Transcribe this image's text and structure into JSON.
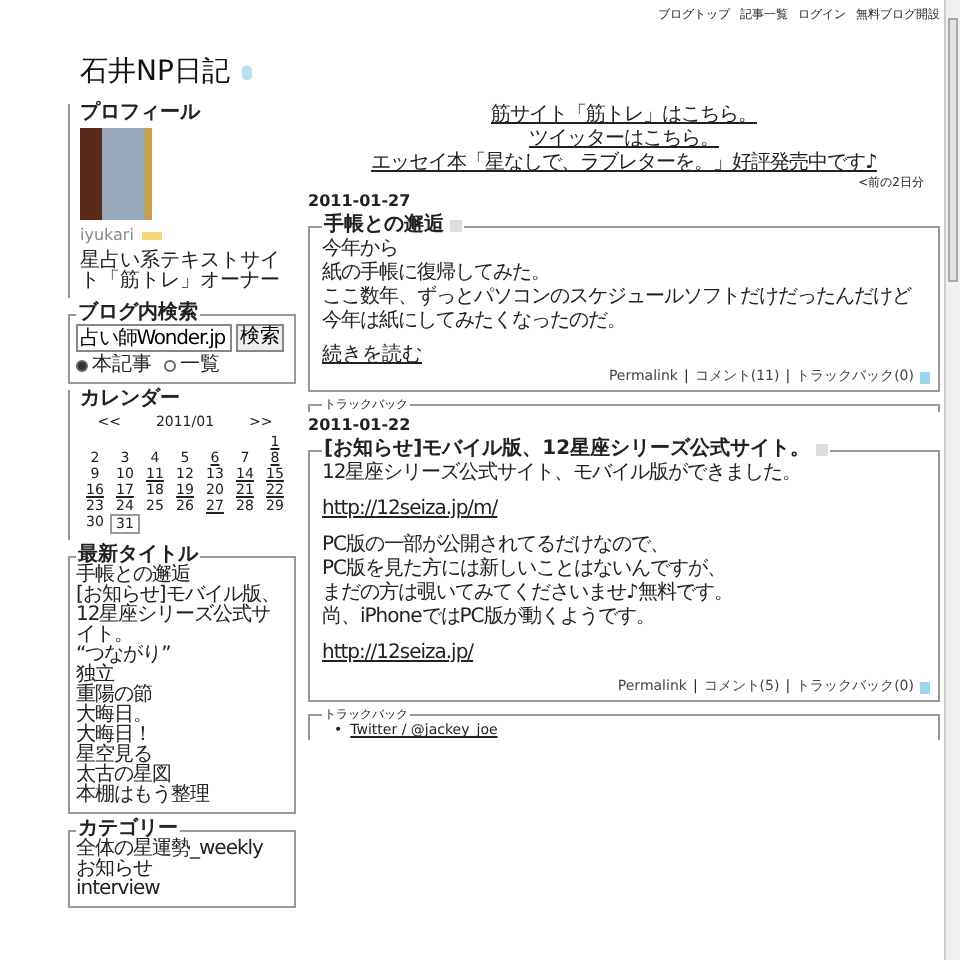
{
  "header_links": [
    "ブログトップ",
    "記事一覧",
    "ログイン",
    "無料ブログ開設"
  ],
  "blog_title": "石井NP日記",
  "sidebar": {
    "profile": {
      "heading": "プロフィール",
      "name": "iyukari",
      "description": "星占い系テキストサイト「筋トレ」オーナー"
    },
    "search": {
      "heading": "ブログ内検索",
      "value": "占い師Wonder.jp",
      "button": "検索",
      "options": [
        {
          "label": "本記事",
          "selected": true
        },
        {
          "label": "一覧",
          "selected": false
        }
      ]
    },
    "calendar": {
      "heading": "カレンダー",
      "prev": "<<",
      "month": "2011/01",
      "next": ">>",
      "weeks": [
        [
          {
            "kind": "empty"
          },
          {
            "kind": "empty"
          },
          {
            "kind": "empty"
          },
          {
            "kind": "empty"
          },
          {
            "kind": "empty"
          },
          {
            "kind": "empty"
          },
          {
            "kind": "day",
            "day": "1",
            "linked": true,
            "today": false
          }
        ],
        [
          {
            "kind": "day",
            "day": "2",
            "linked": false,
            "today": false
          },
          {
            "kind": "day",
            "day": "3",
            "linked": false,
            "today": false
          },
          {
            "kind": "day",
            "day": "4",
            "linked": false,
            "today": false
          },
          {
            "kind": "day",
            "day": "5",
            "linked": false,
            "today": false
          },
          {
            "kind": "day",
            "day": "6",
            "linked": true,
            "today": false
          },
          {
            "kind": "day",
            "day": "7",
            "linked": false,
            "today": false
          },
          {
            "kind": "day",
            "day": "8",
            "linked": true,
            "today": false
          }
        ],
        [
          {
            "kind": "day",
            "day": "9",
            "linked": false,
            "today": false
          },
          {
            "kind": "day",
            "day": "10",
            "linked": false,
            "today": false
          },
          {
            "kind": "day",
            "day": "11",
            "linked": true,
            "today": false
          },
          {
            "kind": "day",
            "day": "12",
            "linked": false,
            "today": false
          },
          {
            "kind": "day",
            "day": "13",
            "linked": false,
            "today": false
          },
          {
            "kind": "day",
            "day": "14",
            "linked": true,
            "today": false
          },
          {
            "kind": "day",
            "day": "15",
            "linked": true,
            "today": false
          }
        ],
        [
          {
            "kind": "day",
            "day": "16",
            "linked": true,
            "today": false
          },
          {
            "kind": "day",
            "day": "17",
            "linked": true,
            "today": false
          },
          {
            "kind": "day",
            "day": "18",
            "linked": false,
            "today": false
          },
          {
            "kind": "day",
            "day": "19",
            "linked": true,
            "today": false
          },
          {
            "kind": "day",
            "day": "20",
            "linked": false,
            "today": false
          },
          {
            "kind": "day",
            "day": "21",
            "linked": true,
            "today": false
          },
          {
            "kind": "day",
            "day": "22",
            "linked": true,
            "today": false
          }
        ],
        [
          {
            "kind": "day",
            "day": "23",
            "linked": false,
            "today": false
          },
          {
            "kind": "day",
            "day": "24",
            "linked": false,
            "today": false
          },
          {
            "kind": "day",
            "day": "25",
            "linked": false,
            "today": false
          },
          {
            "kind": "day",
            "day": "26",
            "linked": false,
            "today": false
          },
          {
            "kind": "day",
            "day": "27",
            "linked": true,
            "today": false
          },
          {
            "kind": "day",
            "day": "28",
            "linked": false,
            "today": false
          },
          {
            "kind": "day",
            "day": "29",
            "linked": false,
            "today": false
          }
        ],
        [
          {
            "kind": "day",
            "day": "30",
            "linked": false,
            "today": false
          },
          {
            "kind": "day",
            "day": "31",
            "linked": false,
            "today": true
          }
        ]
      ]
    },
    "recent": {
      "heading": "最新タイトル",
      "items": [
        "手帳との邂逅",
        "[お知らせ]モバイル版、12星座シリーズ公式サイト。",
        "“つながり”",
        "独立",
        "重陽の節",
        "大晦日。",
        "大晦日！",
        "星空見る",
        "太古の星図",
        "本棚はもう整理"
      ]
    },
    "categories": {
      "heading": "カテゴリー",
      "items": [
        "全体の星運勢_weekly",
        "お知らせ",
        "interview"
      ]
    }
  },
  "notices": [
    "筋サイト「筋トレ」はこちら。",
    "ツイッターはこちら。",
    "エッセイ本「星なしで、ラブレターを。」好評発売中です♪"
  ],
  "prev_nav": "<前の2日分",
  "entries": [
    {
      "date": "2011-01-27",
      "title": "手帳との邂逅",
      "blocks": [
        {
          "kind": "text",
          "text": "今年から"
        },
        {
          "kind": "text",
          "text": "紙の手帳に復帰してみた。"
        },
        {
          "kind": "text",
          "text": "ここ数年、ずっとパソコンのスケジュールソフトだけだったんだけど"
        },
        {
          "kind": "text",
          "text": "今年は紙にしてみたくなったのだ。"
        }
      ],
      "more": "続きを読む",
      "permalink": "Permalink",
      "separator": "|",
      "comments": "コメント(11)",
      "trackbacks": "トラックバック(0)",
      "trackback_heading": "トラックバック"
    },
    {
      "date": "2011-01-22",
      "title": "[お知らせ]モバイル版、12星座シリーズ公式サイト。",
      "blocks": [
        {
          "kind": "text",
          "text": "12星座シリーズ公式サイト、モバイル版ができました。"
        },
        {
          "kind": "link",
          "text": "http://12seiza.jp/m/"
        },
        {
          "kind": "text",
          "text": "PC版の一部が公開されてるだけなので、"
        },
        {
          "kind": "text",
          "text": "PC版を見た方には新しいことはないんですが、"
        },
        {
          "kind": "text",
          "text": "まだの方は覗いてみてくださいませ♪無料です。"
        },
        {
          "kind": "text",
          "text": "尚、iPhoneではPC版が動くようです。"
        },
        {
          "kind": "link",
          "text": "http://12seiza.jp/"
        }
      ],
      "permalink": "Permalink",
      "separator": "|",
      "comments": "コメント(5)",
      "trackbacks": "トラックバック(0)",
      "trackback_heading": "トラックバック",
      "trackback_marker": "•",
      "trackback_items": [
        "Twitter / @jackey_joe"
      ]
    }
  ]
}
